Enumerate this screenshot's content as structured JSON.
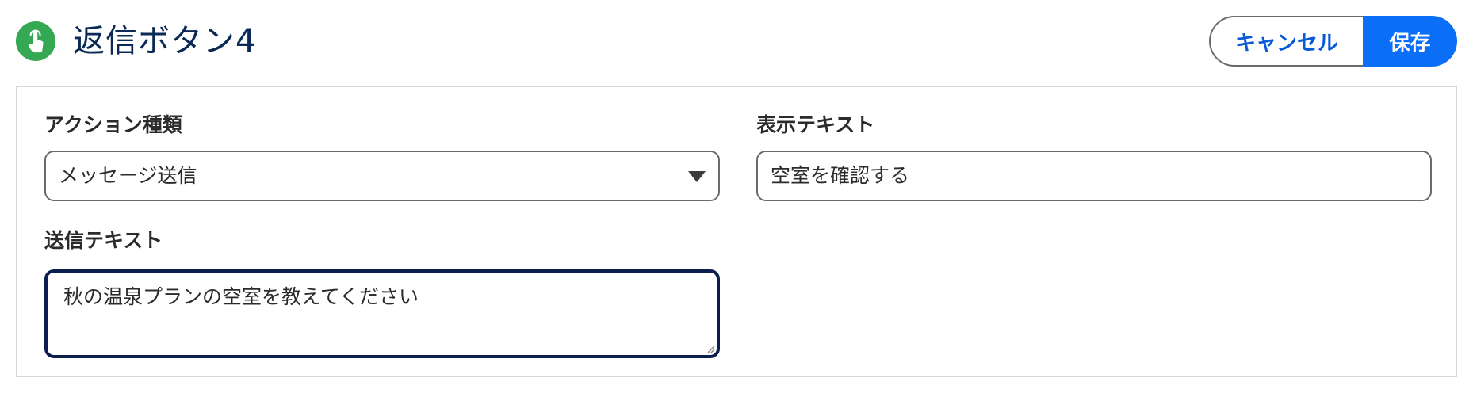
{
  "header": {
    "icon": "tap-hand-icon",
    "title": "返信ボタン4",
    "cancel_label": "キャンセル",
    "save_label": "保存"
  },
  "form": {
    "action_type": {
      "label": "アクション種類",
      "selected": "メッセージ送信"
    },
    "display_text": {
      "label": "表示テキスト",
      "value": "空室を確認する"
    },
    "send_text": {
      "label": "送信テキスト",
      "value": "秋の温泉プランの空室を教えてください"
    }
  },
  "colors": {
    "icon_bg": "#34a853",
    "title": "#0b2a55",
    "accent": "#0b6ef7",
    "cancel_text": "#0a5ad8",
    "focus_border": "#0b1f4f"
  }
}
